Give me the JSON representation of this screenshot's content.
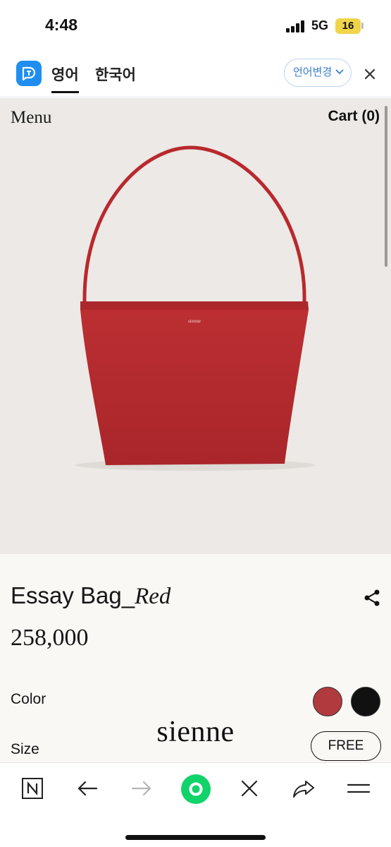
{
  "status_bar": {
    "time": "4:48",
    "network": "5G",
    "battery": "16"
  },
  "translate_bar": {
    "tabs": [
      "영어",
      "한국어"
    ],
    "active_tab": "영어",
    "change_language_label": "언어변경",
    "icons": [
      "translate-logo-icon",
      "chevron-down-icon",
      "close-icon"
    ],
    "accent_color": "#1e8ff0"
  },
  "page": {
    "menu_label": "Menu",
    "cart_label": "Cart (0)",
    "hero_background": "#ece9e6",
    "bag_color": "#b22a2e",
    "bag_logo": "sienne"
  },
  "product": {
    "name": "Essay Bag_",
    "variant": "Red",
    "price": "258,000",
    "color_label": "Color",
    "colors": [
      {
        "name": "red",
        "hex": "#b03a3d",
        "selected": true
      },
      {
        "name": "black",
        "hex": "#111111",
        "selected": false
      }
    ],
    "size_label": "Size",
    "size_option": "FREE",
    "brand": "sienne"
  },
  "toolbar": {
    "icons": [
      "n-icon",
      "back-arrow-icon",
      "forward-arrow-icon",
      "green-dot-icon",
      "close-icon",
      "share-icon",
      "menu-icon"
    ]
  }
}
